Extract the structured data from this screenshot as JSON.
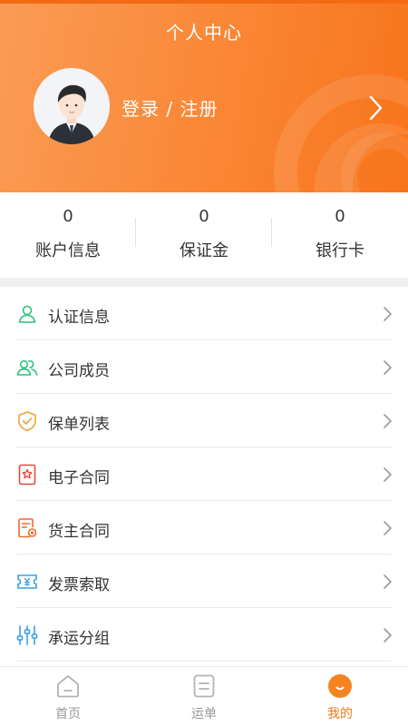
{
  "header": {
    "title": "个人中心",
    "login_label": "登录 / 注册"
  },
  "stats": [
    {
      "value": "0",
      "label": "账户信息"
    },
    {
      "value": "0",
      "label": "保证金"
    },
    {
      "value": "0",
      "label": "银行卡"
    }
  ],
  "menu": {
    "items": [
      {
        "label": "认证信息",
        "icon": "user-icon"
      },
      {
        "label": "公司成员",
        "icon": "users-icon"
      },
      {
        "label": "保单列表",
        "icon": "shield-check-icon"
      },
      {
        "label": "电子合同",
        "icon": "contract-star-icon"
      },
      {
        "label": "货主合同",
        "icon": "contract-seal-icon"
      },
      {
        "label": "发票索取",
        "icon": "invoice-icon"
      },
      {
        "label": "承运分组",
        "icon": "sliders-icon"
      }
    ]
  },
  "tabbar": {
    "items": [
      {
        "label": "首页",
        "icon": "home-icon",
        "active": false
      },
      {
        "label": "运单",
        "icon": "waybill-icon",
        "active": false
      },
      {
        "label": "我的",
        "icon": "profile-icon",
        "active": true
      }
    ]
  },
  "colors": {
    "accent": "#f8741c",
    "green": "#2ec27e",
    "orange_icon": "#f0a23a",
    "red_icon": "#e64a3c",
    "blue_icon": "#3aa0e6"
  }
}
